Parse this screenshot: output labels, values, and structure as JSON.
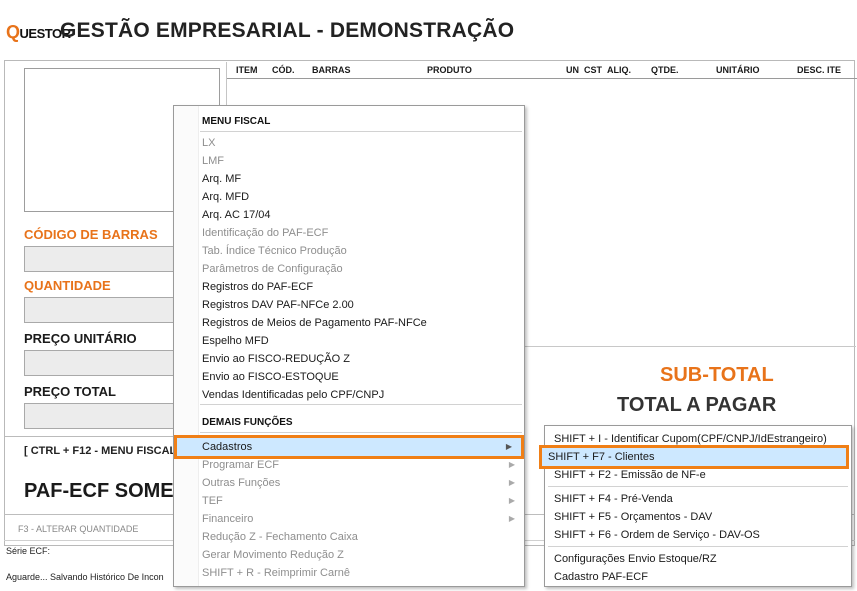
{
  "header": {
    "logo_q": "Q",
    "logo_rest": "UESTOR",
    "title": "GESTÃO EMPRESARIAL - DEMONSTRAÇÃO"
  },
  "table": {
    "columns": [
      "ITEM",
      "CÓD.",
      "BARRAS",
      "PRODUTO",
      "UN",
      "CST",
      "ALIQ.",
      "QTDE.",
      "UNITÁRIO",
      "DESC. ITE"
    ]
  },
  "fields": {
    "barcode_label": "CÓDIGO DE BARRAS",
    "quantity_label": "QUANTIDADE",
    "unit_price_label": "PREÇO UNITÁRIO",
    "total_price_label": "PREÇO TOTAL"
  },
  "totals": {
    "subtotal_label": "SUB-TOTAL",
    "total_label": "TOTAL A PAGAR"
  },
  "shortcuts": {
    "menu_fiscal": "[ CTRL + F12 - MENU FISCAL",
    "alter_qty": "F3 - ALTERAR QUANTIDADE"
  },
  "banner": "PAF-ECF SOME",
  "status": {
    "serie": "Série ECF:",
    "message": "Aguarde... Salvando Histórico De Incon"
  },
  "menu": {
    "items": [
      {
        "label": "MENU FISCAL",
        "kind": "header"
      },
      {
        "label": "LX",
        "kind": "disabled"
      },
      {
        "label": "LMF",
        "kind": "disabled"
      },
      {
        "label": "Arq. MF",
        "kind": "enabled"
      },
      {
        "label": "Arq. MFD",
        "kind": "enabled"
      },
      {
        "label": "Arq. AC 17/04",
        "kind": "enabled"
      },
      {
        "label": "Identificação do PAF-ECF",
        "kind": "disabled"
      },
      {
        "label": "Tab. Índice Técnico Produção",
        "kind": "disabled"
      },
      {
        "label": "Parâmetros de Configuração",
        "kind": "disabled"
      },
      {
        "label": "Registros do PAF-ECF",
        "kind": "enabled"
      },
      {
        "label": "Registros DAV PAF-NFCe 2.00",
        "kind": "enabled"
      },
      {
        "label": "Registros de Meios de Pagamento PAF-NFCe",
        "kind": "enabled"
      },
      {
        "label": "Espelho MFD",
        "kind": "enabled"
      },
      {
        "label": "Envio ao FISCO-REDUÇÃO Z",
        "kind": "enabled"
      },
      {
        "label": "Envio ao FISCO-ESTOQUE",
        "kind": "enabled"
      },
      {
        "label": "Vendas Identificadas pelo CPF/CNPJ",
        "kind": "enabled"
      },
      {
        "label": "DEMAIS FUNÇÕES",
        "kind": "header"
      },
      {
        "label": "Cadastros",
        "kind": "highlight",
        "arrow": "▶"
      },
      {
        "label": "Programar ECF",
        "kind": "disabled",
        "arrow": "▶"
      },
      {
        "label": "Outras Funções",
        "kind": "disabled",
        "arrow": "▶"
      },
      {
        "label": "TEF",
        "kind": "disabled",
        "arrow": "▶"
      },
      {
        "label": "Financeiro",
        "kind": "disabled",
        "arrow": "▶"
      },
      {
        "label": "Redução Z - Fechamento Caixa",
        "kind": "disabled"
      },
      {
        "label": "Gerar Movimento Redução Z",
        "kind": "disabled"
      },
      {
        "label": "SHIFT + R - Reimprimir Carnê",
        "kind": "disabled"
      }
    ]
  },
  "submenu": {
    "items": [
      {
        "label": "SHIFT + I - Identificar Cupom(CPF/CNPJ/IdEstrangeiro)",
        "kind": "enabled"
      },
      {
        "label": "SHIFT + F7 - Clientes",
        "kind": "highlight"
      },
      {
        "label": "SHIFT + F2 - Emissão de NF-e",
        "kind": "enabled"
      },
      {
        "label": "SHIFT + F4 - Pré-Venda",
        "kind": "enabled"
      },
      {
        "label": "SHIFT + F5 - Orçamentos - DAV",
        "kind": "enabled"
      },
      {
        "label": "SHIFT + F6 - Ordem de Serviço - DAV-OS",
        "kind": "enabled"
      },
      {
        "label": "Configurações Envio Estoque/RZ",
        "kind": "enabled"
      },
      {
        "label": "Cadastro PAF-ECF",
        "kind": "enabled"
      }
    ]
  }
}
